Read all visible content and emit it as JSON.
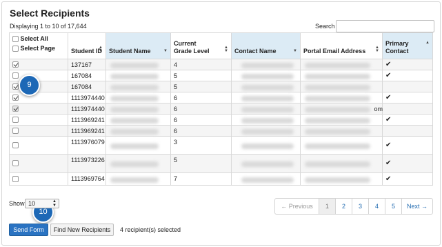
{
  "title": "Select Recipients",
  "displaying": "Displaying 1 to 10 of 17,644",
  "search": {
    "label": "Search",
    "value": ""
  },
  "table": {
    "select_all": "Select All",
    "select_page": "Select Page",
    "headers": {
      "student_id": "Student ID",
      "student_name": "Student Name",
      "grade": "Current Grade Level",
      "contact_name": "Contact Name",
      "portal_email": "Portal Email Address",
      "primary_contact": "Primary Contact"
    },
    "rows": [
      {
        "checked": true,
        "student_id": "137167",
        "grade": "4",
        "email_fragment": "",
        "primary": true
      },
      {
        "checked": false,
        "student_id": "167084",
        "grade": "5",
        "email_fragment": "",
        "primary": true
      },
      {
        "checked": true,
        "student_id": "167084",
        "grade": "5",
        "email_fragment": "",
        "primary": false
      },
      {
        "checked": true,
        "student_id": "1113974440",
        "grade": "6",
        "email_fragment": "",
        "primary": true
      },
      {
        "checked": true,
        "student_id": "1113974440",
        "grade": "6",
        "email_fragment": "om",
        "primary": false
      },
      {
        "checked": false,
        "student_id": "1113969241",
        "grade": "6",
        "email_fragment": "",
        "primary": true
      },
      {
        "checked": false,
        "student_id": "1113969241",
        "grade": "6",
        "email_fragment": "",
        "primary": false
      },
      {
        "checked": false,
        "student_id": "1113976079",
        "grade": "3",
        "email_fragment": "",
        "primary": true
      },
      {
        "checked": false,
        "student_id": "1113973226",
        "grade": "5",
        "email_fragment": "",
        "primary": true
      },
      {
        "checked": false,
        "student_id": "1113969764",
        "grade": "7",
        "email_fragment": "",
        "primary": true
      }
    ]
  },
  "callouts": {
    "first": "9",
    "second": "10"
  },
  "show": {
    "label": "Show",
    "value": "10"
  },
  "pagination": {
    "previous": "← Previous",
    "pages": [
      "1",
      "2",
      "3",
      "4",
      "5"
    ],
    "next": "Next →",
    "active": "1"
  },
  "buttons": {
    "send_form": "Send Form",
    "find_new": "Find New Recipients"
  },
  "selected_count": "4 recipient(s) selected",
  "colors": {
    "primary": "#2a73c2",
    "callout": "#1d68b6",
    "header_highlight": "#dcebf5",
    "link": "#1f6ab0"
  }
}
